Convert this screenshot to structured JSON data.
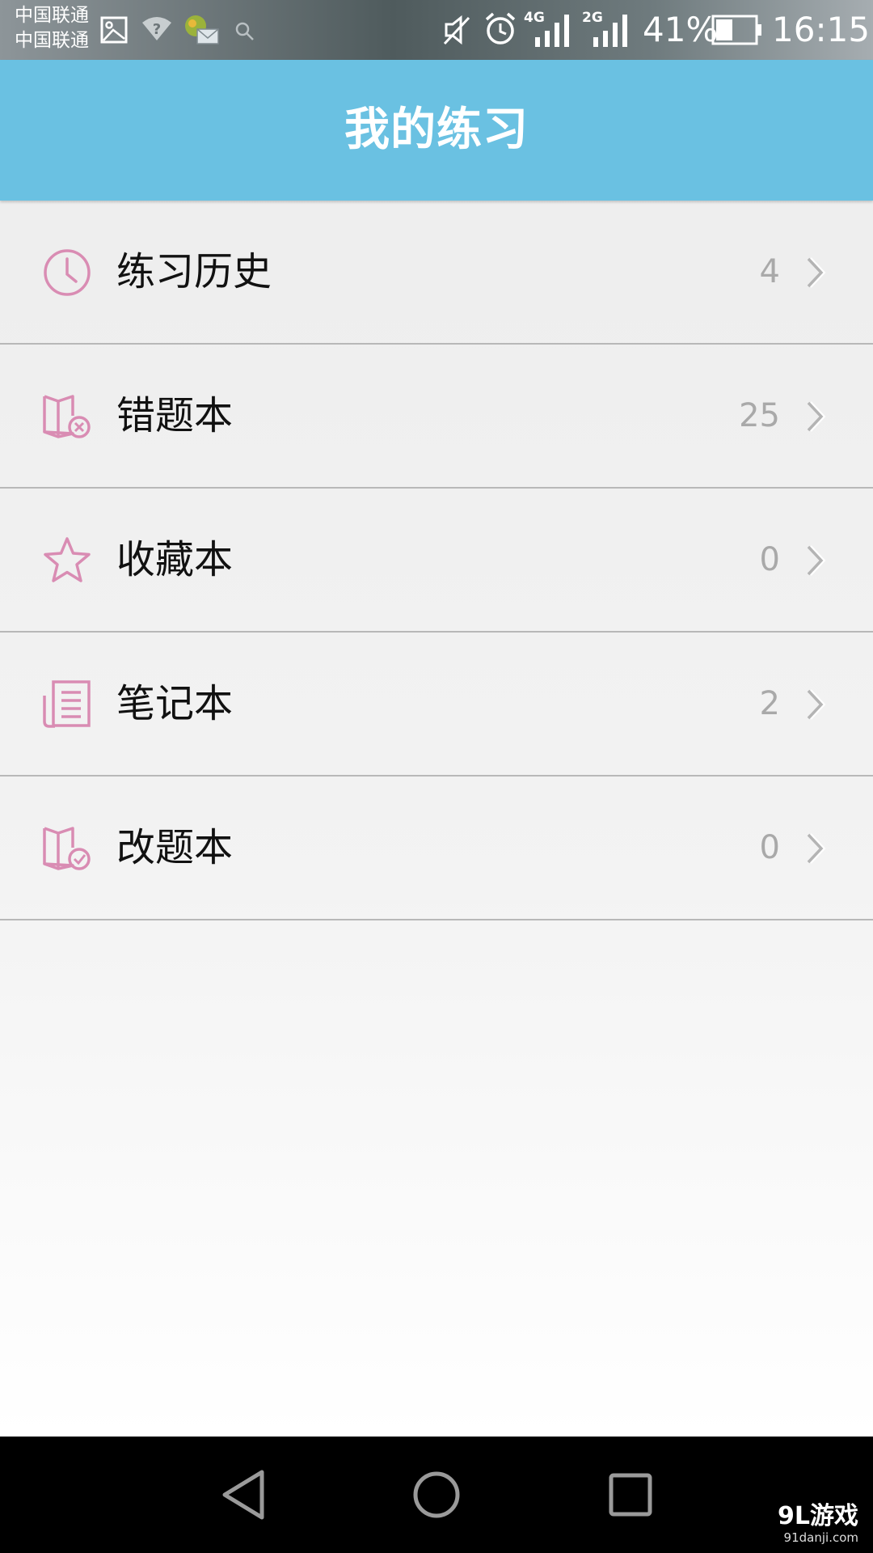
{
  "status_bar": {
    "carrier_1": "中国联通",
    "carrier_2": "中国联通",
    "net_1": "4G",
    "net_2": "2G",
    "battery_percent": "41%",
    "time": "16:15"
  },
  "header": {
    "title": "我的练习"
  },
  "menu": {
    "items": [
      {
        "label": "练习历史",
        "count": "4",
        "icon": "clock-icon"
      },
      {
        "label": "错题本",
        "count": "25",
        "icon": "book-error-icon"
      },
      {
        "label": "收藏本",
        "count": "0",
        "icon": "star-icon"
      },
      {
        "label": "笔记本",
        "count": "2",
        "icon": "notebook-icon"
      },
      {
        "label": "改题本",
        "count": "0",
        "icon": "book-check-icon"
      }
    ]
  },
  "watermark": {
    "logo": "9L游戏",
    "url": "91danji.com"
  },
  "colors": {
    "header_bg": "#6ac1e2",
    "icon_pink": "#d98cb3",
    "count_gray": "#a9a9a9"
  }
}
